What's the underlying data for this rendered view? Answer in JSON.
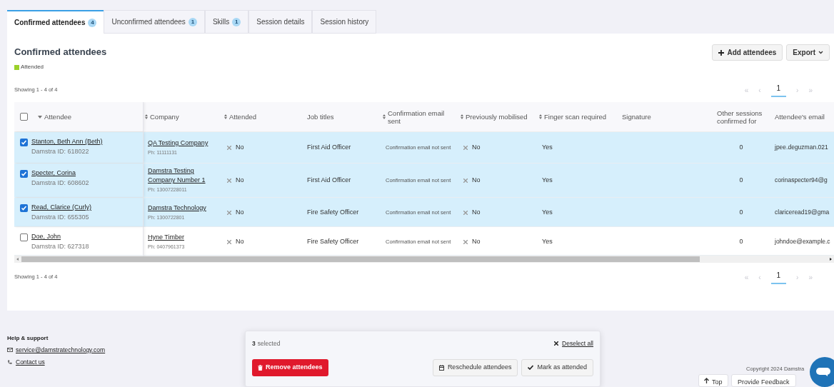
{
  "tabs": [
    {
      "label": "Confirmed attendees",
      "count": "4",
      "selected": true
    },
    {
      "label": "Unconfirmed attendees",
      "count": "1",
      "selected": false
    },
    {
      "label": "Skills",
      "count": "1",
      "selected": false
    },
    {
      "label": "Session details",
      "selected": false
    },
    {
      "label": "Session history",
      "selected": false
    }
  ],
  "title": "Confirmed attendees",
  "actions": [
    {
      "kind": "add",
      "label": "Add attendees"
    },
    {
      "kind": "export",
      "label": "Export"
    }
  ],
  "legend": {
    "label": "Attended"
  },
  "showing_top": "Showing 1 - 4 of 4",
  "pagination_top": {
    "first": "«",
    "prev": "‹",
    "page": "1",
    "next": "›",
    "last": "»"
  },
  "table": {
    "select_all": {
      "checked": false
    },
    "columns": [
      {
        "label": "Attendee",
        "sorted": true
      },
      {
        "label": "Company",
        "sortable": true,
        "sorted": false
      },
      {
        "label": "Attended",
        "sortable": true,
        "sorted": false
      },
      {
        "label": "Job titles",
        "sortable": false,
        "sorted": false
      },
      {
        "label": "Confirmation email sent",
        "sortable": true,
        "sorted": false
      },
      {
        "label": "Previously mobilised",
        "sortable": true,
        "sorted": false
      },
      {
        "label": "Finger scan required",
        "sortable": true,
        "sorted": false
      },
      {
        "label": "Signature",
        "sortable": false,
        "sorted": false
      },
      {
        "label": "Other sessions confirmed for",
        "sortable": false,
        "sorted": false
      },
      {
        "label": "Attendee's email",
        "sortable": false,
        "sorted": false
      }
    ],
    "rows": [
      {
        "selected": true,
        "name": "Stanton, Beth Ann (Beth)",
        "id": "Damstra ID: 618022",
        "company": "QA Testing Company",
        "phone": "Ph: 11111131",
        "attended": "No",
        "job": "First Aid Officer",
        "confirmation": "Confirmation email not sent",
        "mobilised": "No",
        "finger": "Yes",
        "other": "0",
        "email": "jpee.deguzman.021"
      },
      {
        "selected": true,
        "name": "Specter, Corina",
        "id": "Damstra ID: 608602",
        "company": "Damstra Testing Company Number 1",
        "phone": "Ph: 13007228011",
        "attended": "No",
        "job": "First Aid Officer",
        "confirmation": "Confirmation email not sent",
        "mobilised": "No",
        "finger": "Yes",
        "other": "0",
        "email": "corinaspecter94@g"
      },
      {
        "selected": true,
        "name": "Read, Clarice (Curly)",
        "id": "Damstra ID: 655305",
        "company": "Damstra Technology",
        "phone": "Ph: 1300722801",
        "attended": "No",
        "job": "Fire Safety Officer",
        "confirmation": "Confirmation email not sent",
        "mobilised": "No",
        "finger": "Yes",
        "other": "0",
        "email": "clariceread19@gma"
      },
      {
        "selected": false,
        "name": "Doe, John",
        "id": "Damstra ID: 627318",
        "company": "Hyne Timber",
        "phone": "Ph: 0407961373",
        "attended": "No",
        "job": "Fire Safety Officer",
        "confirmation": "Confirmation email not sent",
        "mobilised": "No",
        "finger": "Yes",
        "other": "0",
        "email": "johndoe@example.c"
      }
    ]
  },
  "showing_bottom": "Showing 1 - 4 of 4",
  "pagination_bottom": {
    "first": "«",
    "prev": "‹",
    "page": "1",
    "next": "›",
    "last": "»"
  },
  "footer": {
    "heading": "Help & support",
    "email": "service@damstratechnology.com",
    "contact": "Contact us",
    "copyright": "Copyright 2024 Damstra",
    "top": "Top",
    "feedback": "Provide Feedback"
  },
  "selection": {
    "count": "3",
    "label": "selected",
    "deselect": "Deselect all",
    "buttons": [
      {
        "kind": "remove",
        "label": "Remove attendees"
      },
      {
        "kind": "reschedule",
        "label": "Reschedule attendees"
      },
      {
        "kind": "mark",
        "label": "Mark as attended"
      }
    ]
  }
}
